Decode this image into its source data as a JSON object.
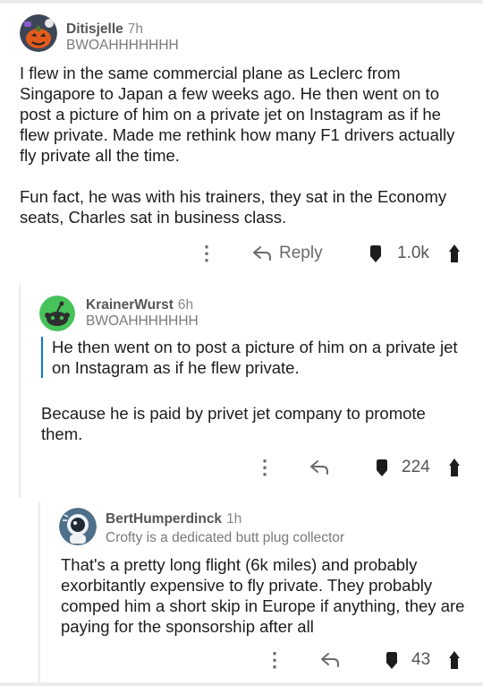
{
  "comments": [
    {
      "author": "Ditisjelle",
      "age": "7h",
      "flair": "BWOAHHHHHHH",
      "paragraphs": [
        "I flew in the same commercial plane as Leclerc from Singapore to Japan a few weeks ago. He then went on to post a picture of him on a private jet on Instagram as if he flew private. Made me rethink how many F1 drivers actually fly private all the time.",
        "Fun fact, he was with his trainers, they sat in the Economy seats, Charles sat in business class."
      ],
      "reply_label": "Reply",
      "score": "1.0k"
    },
    {
      "author": "KrainerWurst",
      "age": "6h",
      "flair": "BWOAHHHHHHH",
      "quote": "He then went on to post a picture of him on a private jet on Instagram as if he flew private.",
      "paragraphs": [
        "Because he is paid by privet jet company to promote them."
      ],
      "score": "224"
    },
    {
      "author": "BertHumperdinck",
      "age": "1h",
      "flair": "Crofty is a dedicated butt plug collector",
      "paragraphs": [
        "That's a pretty long flight (6k miles) and probably exorbitantly expensive to fly private. They probably comped him a short skip in Europe if anything, they are paying for the sponsorship after all"
      ],
      "score": "43"
    }
  ],
  "icons": {
    "more": "more-options-icon",
    "reply": "reply-arrow-icon",
    "downvote": "downvote-icon",
    "upvote": "upvote-icon"
  },
  "colors": {
    "quote_bar": "#0079d3",
    "avatar_green": "#46c35a",
    "avatar_orange": "#e25a1c",
    "thread_line": "#ebebeb"
  }
}
